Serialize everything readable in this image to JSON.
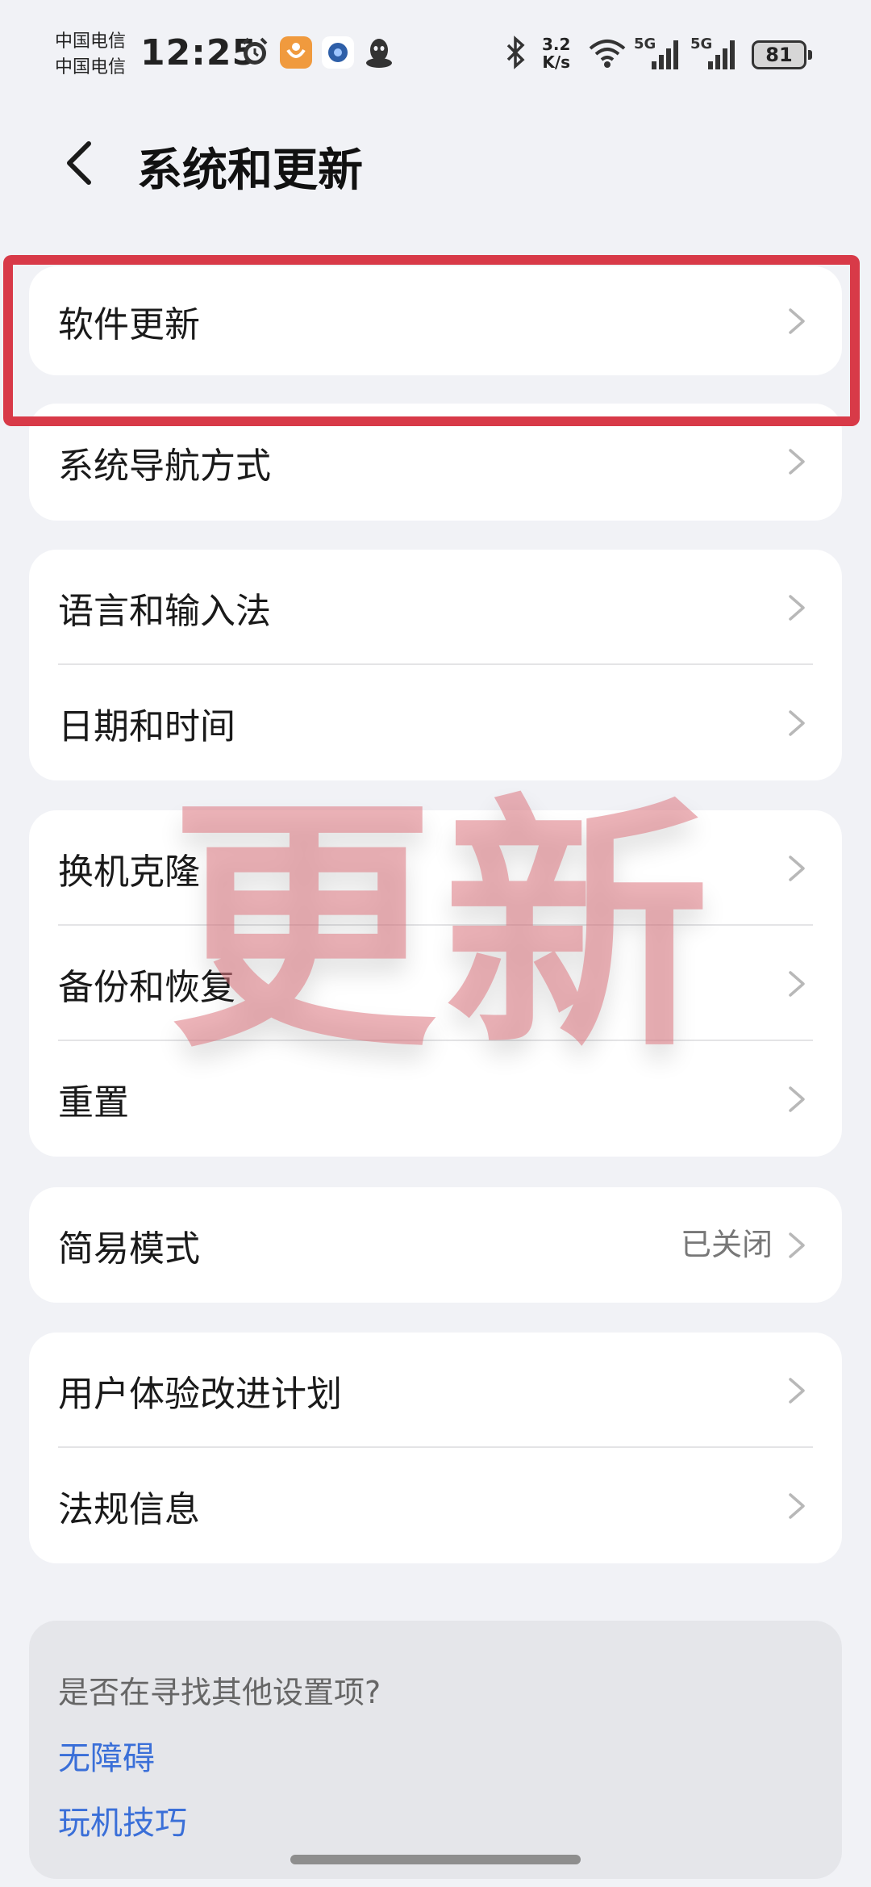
{
  "status_bar": {
    "carrier_1": "中国电信",
    "carrier_2": "中国电信",
    "time": "12:25",
    "net_speed_value": "3.2",
    "net_speed_unit": "K/s",
    "signal_1_label": "5G",
    "signal_2_label": "5G",
    "battery": "81",
    "icons": [
      "alarm-icon",
      "app-icon-orange",
      "app-icon-blue",
      "qq-icon",
      "bluetooth-icon",
      "wifi-icon",
      "signal-icon",
      "battery-icon"
    ]
  },
  "header": {
    "title": "系统和更新",
    "back_icon": "chevron-left-icon"
  },
  "groups": [
    {
      "items": [
        {
          "label": "软件更新",
          "highlighted": true
        }
      ]
    },
    {
      "items": [
        {
          "label": "系统导航方式"
        }
      ]
    },
    {
      "items": [
        {
          "label": "语言和输入法"
        },
        {
          "label": "日期和时间"
        }
      ]
    },
    {
      "items": [
        {
          "label": "换机克隆"
        },
        {
          "label": "备份和恢复"
        },
        {
          "label": "重置"
        }
      ]
    },
    {
      "items": [
        {
          "label": "简易模式",
          "value": "已关闭"
        }
      ]
    },
    {
      "items": [
        {
          "label": "用户体验改进计划"
        },
        {
          "label": "法规信息"
        }
      ]
    }
  ],
  "suggestions": {
    "title": "是否在寻找其他设置项?",
    "links": [
      "无障碍",
      "玩机技巧"
    ]
  },
  "watermark": "更新",
  "colors": {
    "background": "#f1f2f6",
    "highlight": "#d83a48",
    "link": "#3a6fd8",
    "watermark": "#de7680"
  }
}
